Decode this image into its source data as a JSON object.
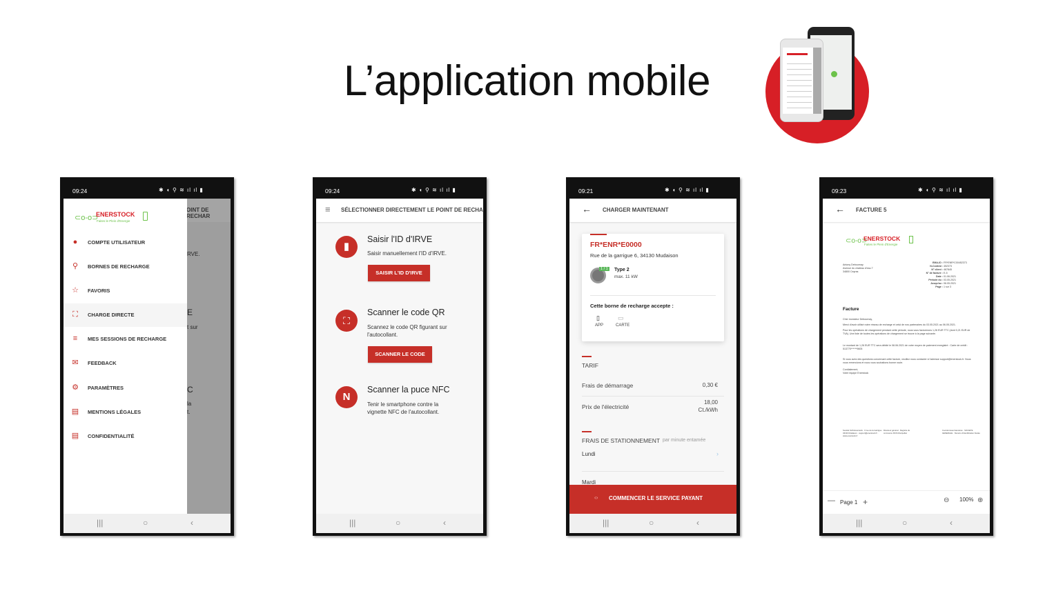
{
  "page_title": "L’application mobile",
  "colors": {
    "brand_red": "#c62f28",
    "circle_red": "#d71f26",
    "logo_green": "#6cc24a"
  },
  "logo": {
    "name": "ENERSTOCK",
    "tagline": "Faites le Plein d'Energie"
  },
  "status_icons": "✱ ◖ ⚲ ≋ ıl ıl ▮",
  "nav_icons": {
    "recents": "|||",
    "home": "○",
    "back": "‹"
  },
  "phone1": {
    "time": "09:24",
    "menu": [
      {
        "label": "COMPTE UTILISATEUR",
        "icon": "user-icon"
      },
      {
        "label": "BORNES DE RECHARGE",
        "icon": "location-pin-icon"
      },
      {
        "label": "FAVORIS",
        "icon": "star-icon"
      },
      {
        "label": "CHARGE DIRECTE",
        "icon": "scan-frame-icon",
        "active": true
      },
      {
        "label": "MES SESSIONS DE RECHARGE",
        "icon": "list-icon"
      },
      {
        "label": "FEEDBACK",
        "icon": "envelope-icon"
      },
      {
        "label": "PARAMÈTRES",
        "icon": "gear-icon"
      },
      {
        "label": "MENTIONS LÉGALES",
        "icon": "document-icon"
      },
      {
        "label": "CONFIDENTIALITÉ",
        "icon": "document-icon"
      }
    ],
    "behind": {
      "header": "OINT DE RECHAR",
      "t1": "RVE.",
      "t2": "E",
      "t3": "t sur",
      "t4": "C",
      "t5": "la",
      "t6": "t."
    }
  },
  "phone2": {
    "time": "09:24",
    "header_title": "SÉLECTIONNER DIRECTEMENT LE POINT DE RECHARGE",
    "options": [
      {
        "title": "Saisir l'ID d'IRVE",
        "desc": "Saisir manuellement l'ID d'IRVE.",
        "button": "SAISIR L'ID D'IRVE",
        "icon": "charger-plug-icon"
      },
      {
        "title": "Scanner le code QR",
        "desc": "Scannez le code QR figurant sur l'autocollant.",
        "button": "SCANNER LE CODE",
        "icon": "qr-scan-icon"
      },
      {
        "title": "Scanner la puce NFC",
        "desc": "Tenir le smartphone contre la vignette NFC de l'autocollant.",
        "icon": "nfc-icon"
      }
    ]
  },
  "phone3": {
    "time": "09:21",
    "header_title": "CHARGER MAINTENANT",
    "station_id": "FR*ENR*E0000",
    "address": "Rue de la garrigue 6, 34130 Mudaison",
    "connector": {
      "badge": "1 / 1",
      "type": "Type 2",
      "power": "max. 11 kW"
    },
    "accepts_label": "Cette borne de recharge accepte :",
    "payment_methods": [
      {
        "label": "APP",
        "icon": "phone-icon"
      },
      {
        "label": "CARTE",
        "icon": "card-icon"
      }
    ],
    "tarif_title": "TARIF",
    "tarif": [
      {
        "label": "Frais de démarrage",
        "value": "0,30 €"
      },
      {
        "label": "Prix de l'électricité",
        "value": "18,00",
        "unit": "Ct./kWh"
      }
    ],
    "parking_title": "FRAIS DE STATIONNEMENT",
    "parking_sub": "par minute entamée",
    "days": [
      "Lundi",
      "Mardi"
    ],
    "cta": "COMMENCER LE SERVICE PAYANT"
  },
  "phone4": {
    "time": "09:23",
    "header_title": "FACTURE 5",
    "invoice": {
      "address": [
        "Antony Debournay",
        "Avenue du chateau d'eau 7",
        "34800 Ceyras"
      ],
      "fields": [
        {
          "k": "EMA-ID :",
          "v": "FR*ENR*C00452373"
        },
        {
          "k": "N-Contrat :",
          "v": "452373"
        },
        {
          "k": "N° client :",
          "v": "467845"
        },
        {
          "k": "N° de facture :",
          "v": "E-5"
        },
        {
          "k": "Date :",
          "v": "01.06.2021"
        },
        {
          "k": "Période du :",
          "v": "03.05.2021"
        },
        {
          "k": "Jusqu'au :",
          "v": "06.05.2021"
        },
        {
          "k": "Page :",
          "v": "1 sur 3"
        }
      ],
      "heading": "Facture",
      "body": [
        "Cher monsieur Debournay,",
        "Merci d'avoir utilisé notre réseau de recharge et celui de nos partenaires du 03.05.2021 au 06.05.2021.",
        "Pour les opérations de chargement pendant cette période, nous vous facturerons 1,26 EUR TTC (dont 0,21 EUR de TVA). Une liste de toutes les opérations de chargement se trouve à la page suivante.",
        "Le montant de 1,26 EUR TTC sera débité le 08.06.2021 de votre moyen de paiement enregistré : Carte de crédit : 513770******9605",
        "Si vous avez des questions concernant cette facture, veuillez nous contacter à l'adresse support@enerstock.fr. Nous vous remercions et nous vous souhaitons bonne route.",
        "Cordialement,",
        "Votre équipe Enerstock"
      ],
      "footer": [
        "Société SAS Enerstock · 6 rue de la Garrigue · 34130 Mudaison · support@enerstock.fr · www.enerstock.fr",
        "Directeur général · Registre du commerce RCS Montpellier",
        "Coordonnées bancaires · SOCIETE GENERALE · Numéro d'identification fiscale"
      ]
    },
    "page_label": "Page 1",
    "zoom": "100%"
  }
}
